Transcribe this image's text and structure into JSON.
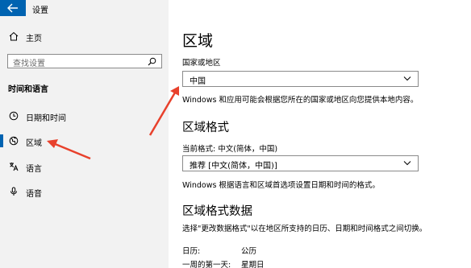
{
  "app": {
    "title": "设置"
  },
  "sidebar": {
    "home_label": "主页",
    "search_placeholder": "查找设置",
    "section_title": "时间和语言",
    "items": [
      {
        "label": "日期和时间",
        "icon": "clock-icon",
        "active": false
      },
      {
        "label": "区域",
        "icon": "globe-icon",
        "active": true
      },
      {
        "label": "语言",
        "icon": "language-icon",
        "active": false
      },
      {
        "label": "语音",
        "icon": "microphone-icon",
        "active": false
      }
    ]
  },
  "main": {
    "title": "区域",
    "country": {
      "label": "国家或地区",
      "value": "中国",
      "description": "Windows 和应用可能会根据您所在的国家或地区向您提供本地内容。"
    },
    "format": {
      "heading": "区域格式",
      "current_label": "当前格式: 中文(简体，中国)",
      "value": "推荐 [中文(简体，中国)]",
      "description": "Windows 根据语言和区域首选项设置日期和时间的格式。"
    },
    "format_data": {
      "heading": "区域格式数据",
      "description": "选择\"更改数据格式\"以在地区所支持的日历、日期和时间格式之间切换。",
      "rows": [
        {
          "key": "日历:",
          "value": "公历"
        },
        {
          "key": "一周的第一天:",
          "value": "星期日"
        }
      ]
    }
  },
  "colors": {
    "accent": "#0063b1",
    "annotation": "#e8412c"
  }
}
